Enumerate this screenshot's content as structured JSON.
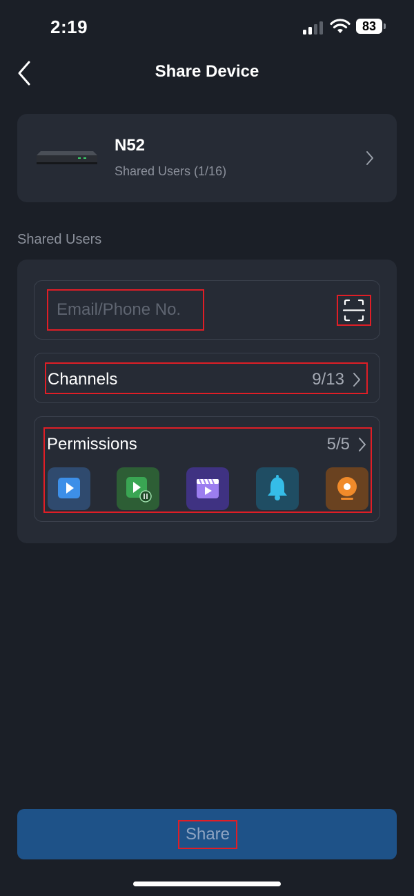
{
  "status_bar": {
    "time": "2:19",
    "battery": "83"
  },
  "nav": {
    "title": "Share Device",
    "back_icon": "chevron-left-icon"
  },
  "device": {
    "name": "N52",
    "subtitle": "Shared Users (1/16)",
    "image_icon": "nvr-device-icon"
  },
  "section_label": "Shared Users",
  "form": {
    "email_placeholder": "Email/Phone No.",
    "scan_icon": "scan-icon",
    "channels": {
      "label": "Channels",
      "value": "9/13"
    },
    "permissions": {
      "label": "Permissions",
      "value": "5/5",
      "icons": [
        {
          "name": "live-view-icon",
          "color": "#2f4a6e"
        },
        {
          "name": "playback-icon",
          "color": "#2d5e35"
        },
        {
          "name": "video-clip-icon",
          "color": "#3f3282"
        },
        {
          "name": "alarm-bell-icon",
          "color": "#1f4d63"
        },
        {
          "name": "camera-ptz-icon",
          "color": "#6a4220"
        }
      ]
    }
  },
  "share_button": {
    "label": "Share"
  },
  "colors": {
    "background": "#1b1f27",
    "card": "#262b35",
    "accent_button": "#1e5288",
    "highlight_box": "#e01e26"
  }
}
